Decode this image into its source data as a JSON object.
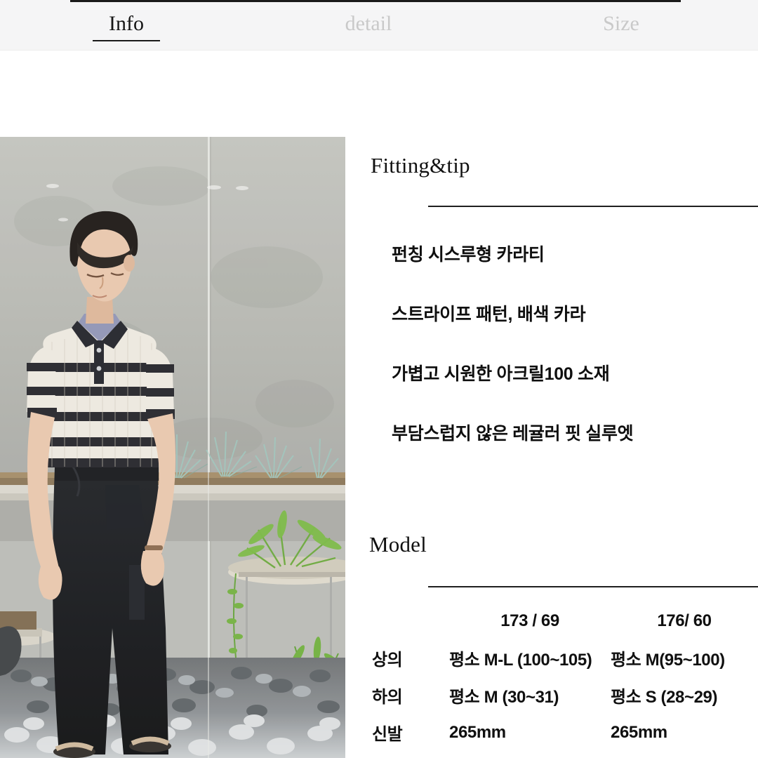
{
  "tabs": [
    {
      "label": "Info",
      "active": true,
      "name": "tab-info"
    },
    {
      "label": "detail",
      "active": false,
      "name": "tab-detail"
    },
    {
      "label": "Size",
      "active": false,
      "name": "tab-size"
    }
  ],
  "photo": {
    "alt": "model-wearing-striped-knit-polo-and-black-wide-pants-outdoor-garden",
    "colors": {
      "wall": "#b5b7b2",
      "gravel_dark": "#585c5f",
      "gravel_light": "#d2d5d7",
      "grass": "#9fc0b6",
      "fern": "#6aa83c",
      "pants": "#14161a",
      "knit_cream": "#ece9e1",
      "knit_stripe": "#22242a",
      "skin": "#e8c7ae",
      "hair": "#1b1715"
    }
  },
  "fitting": {
    "heading": "Fitting&tip",
    "bullets": [
      "펀칭 시스루형 카라티",
      "스트라이프 패턴, 배색 카라",
      "가볍고 시원한 아크릴100 소재",
      "부담스럽지 않은 레귤러 핏 실루엣"
    ]
  },
  "model": {
    "heading": "Model",
    "columns": [
      "",
      "173 / 69",
      "176/ 60"
    ],
    "rows": [
      {
        "label": "상의",
        "a": "평소 M-L (100~105)",
        "b": "평소 M(95~100)"
      },
      {
        "label": "하의",
        "a": "평소 M (30~31)",
        "b": "평소 S (28~29)"
      },
      {
        "label": "신발",
        "a": "265mm",
        "b": "265mm"
      }
    ]
  },
  "theme": {
    "accent": "#1a1a1a",
    "tab_bar_bg": "#f5f5f6",
    "inactive_tab": "#c9c9c9",
    "text": "#101010"
  }
}
